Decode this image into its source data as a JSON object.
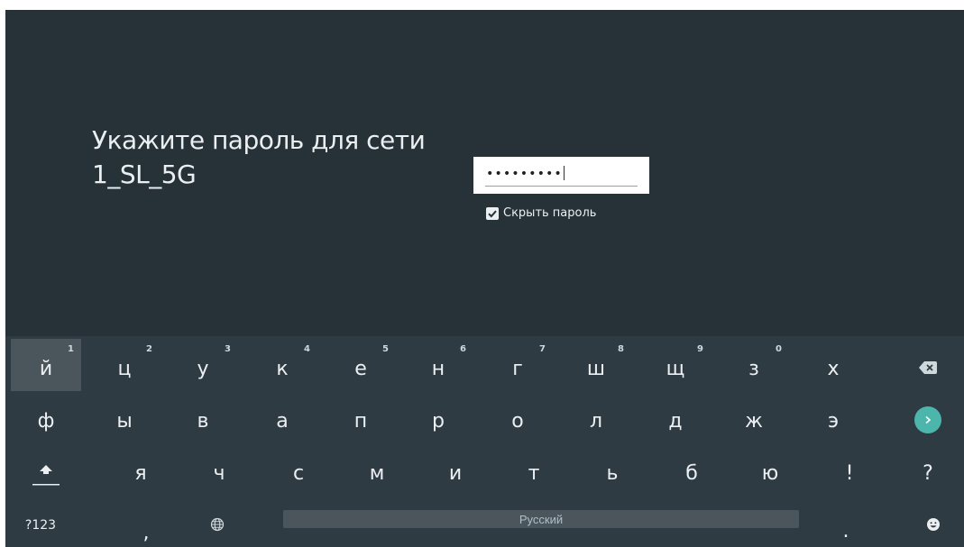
{
  "dialog": {
    "title_line1": "Укажите пароль для сети",
    "title_line2": "1_SL_5G",
    "password_masked": "•••••••••",
    "hide_password_label": "Скрыть пароль",
    "hide_password_checked": true
  },
  "keyboard": {
    "row1": [
      {
        "label": "й",
        "hint": "1"
      },
      {
        "label": "ц",
        "hint": "2"
      },
      {
        "label": "у",
        "hint": "3"
      },
      {
        "label": "к",
        "hint": "4"
      },
      {
        "label": "е",
        "hint": "5"
      },
      {
        "label": "н",
        "hint": "6"
      },
      {
        "label": "г",
        "hint": "7"
      },
      {
        "label": "ш",
        "hint": "8"
      },
      {
        "label": "щ",
        "hint": "9"
      },
      {
        "label": "з",
        "hint": "0"
      },
      {
        "label": "х",
        "hint": ""
      }
    ],
    "row2": [
      "ф",
      "ы",
      "в",
      "а",
      "п",
      "р",
      "о",
      "л",
      "д",
      "ж",
      "э"
    ],
    "row3": [
      "я",
      "ч",
      "с",
      "м",
      "и",
      "т",
      "ь",
      "б",
      "ю",
      "!",
      "?"
    ],
    "row4": {
      "symbols_label": "?123",
      "comma_label": ",",
      "space_label": "Русский",
      "period_label": "."
    },
    "selected_key": "й",
    "colors": {
      "accent": "#4db6ac",
      "background": "#263238",
      "keyboard": "#2f3b42"
    }
  }
}
